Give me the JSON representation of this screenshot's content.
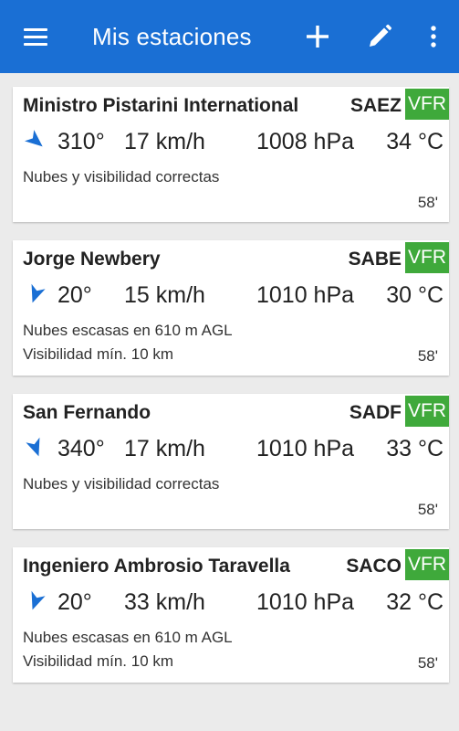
{
  "appbar": {
    "title": "Mis estaciones",
    "color": "#1a6fd4",
    "icons": [
      "menu-icon",
      "add-icon",
      "edit-icon",
      "more-vert-icon"
    ]
  },
  "flight_rule_color": "#3fa93b",
  "stations": [
    {
      "name": "Ministro Pistarini International",
      "code": "SAEZ",
      "category": "VFR",
      "wind_dir": "310°",
      "wind_deg": 310,
      "wind_speed": "17 km/h",
      "pressure": "1008 hPa",
      "temperature": "34 °C",
      "line1": "Nubes y visibilidad correctas",
      "line2": "",
      "age": "58'"
    },
    {
      "name": "Jorge Newbery",
      "code": "SABE",
      "category": "VFR",
      "wind_dir": "20°",
      "wind_deg": 20,
      "wind_speed": "15 km/h",
      "pressure": "1010 hPa",
      "temperature": "30 °C",
      "line1": "Nubes escasas en 610 m AGL",
      "line2": "Visibilidad mín. 10 km",
      "age": "58'"
    },
    {
      "name": "San Fernando",
      "code": "SADF",
      "category": "VFR",
      "wind_dir": "340°",
      "wind_deg": 340,
      "wind_speed": "17 km/h",
      "pressure": "1010 hPa",
      "temperature": "33 °C",
      "line1": "Nubes y visibilidad correctas",
      "line2": "",
      "age": "58'"
    },
    {
      "name": "Ingeniero Ambrosio Taravella",
      "code": "SACO",
      "category": "VFR",
      "wind_dir": "20°",
      "wind_deg": 20,
      "wind_speed": "33 km/h",
      "pressure": "1010 hPa",
      "temperature": "32 °C",
      "line1": "Nubes escasas en 610 m AGL",
      "line2": "Visibilidad mín. 10 km",
      "age": "58'"
    }
  ]
}
